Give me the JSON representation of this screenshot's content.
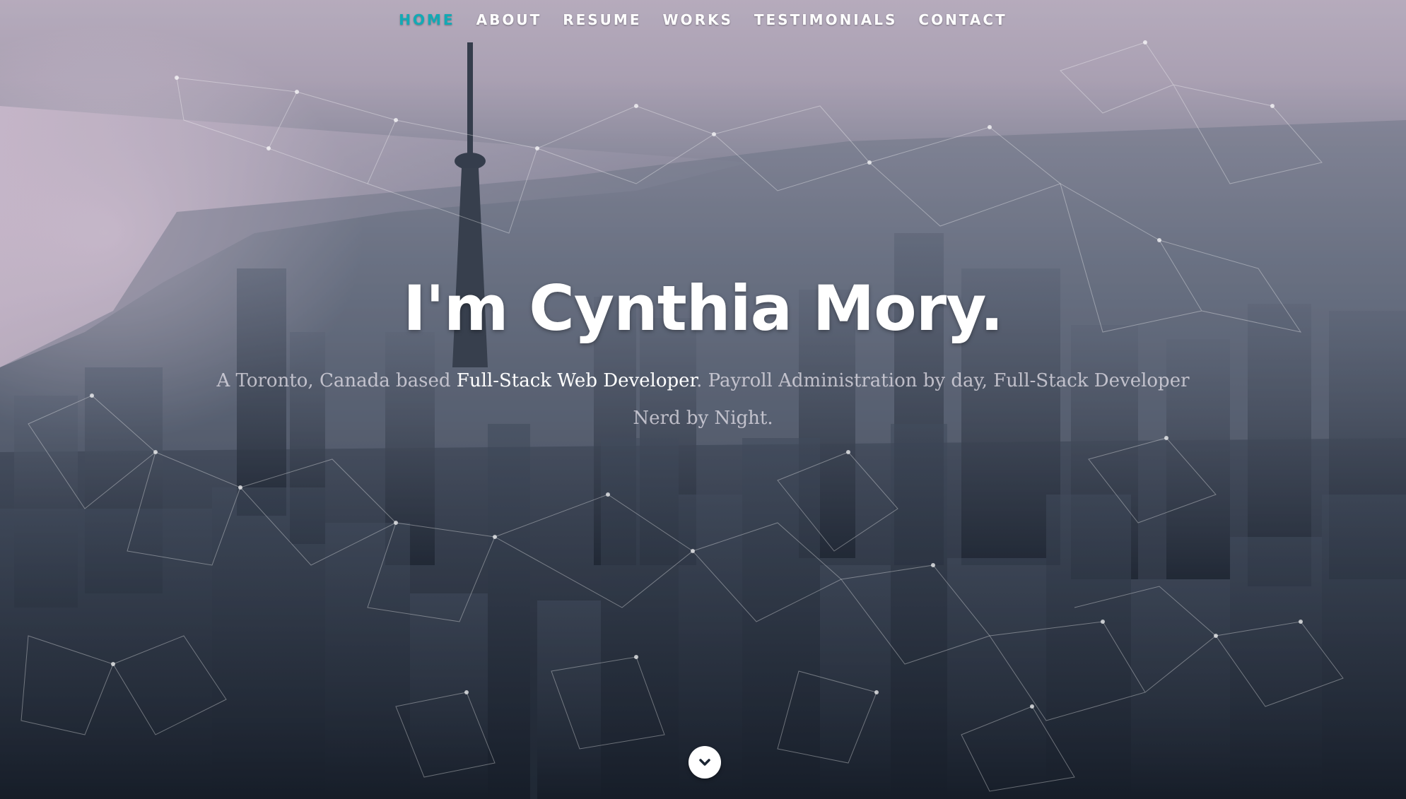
{
  "nav": {
    "items": [
      {
        "label": "HOME",
        "active": true
      },
      {
        "label": "ABOUT",
        "active": false
      },
      {
        "label": "RESUME",
        "active": false
      },
      {
        "label": "WORKS",
        "active": false
      },
      {
        "label": "TESTIMONIALS",
        "active": false
      },
      {
        "label": "CONTACT",
        "active": false
      }
    ]
  },
  "hero": {
    "headline": "I'm Cynthia Mory.",
    "intro_prefix": "A Toronto, Canada based ",
    "intro_highlight": "Full-Stack Web Developer",
    "intro_mid": ". Payroll Administration by day, Full-Stack Developer",
    "intro_suffix": "Nerd by Night."
  },
  "scroll_button": {
    "icon": "chevron-down-icon"
  },
  "colors": {
    "accent": "#11aab5",
    "text": "#ffffff"
  }
}
